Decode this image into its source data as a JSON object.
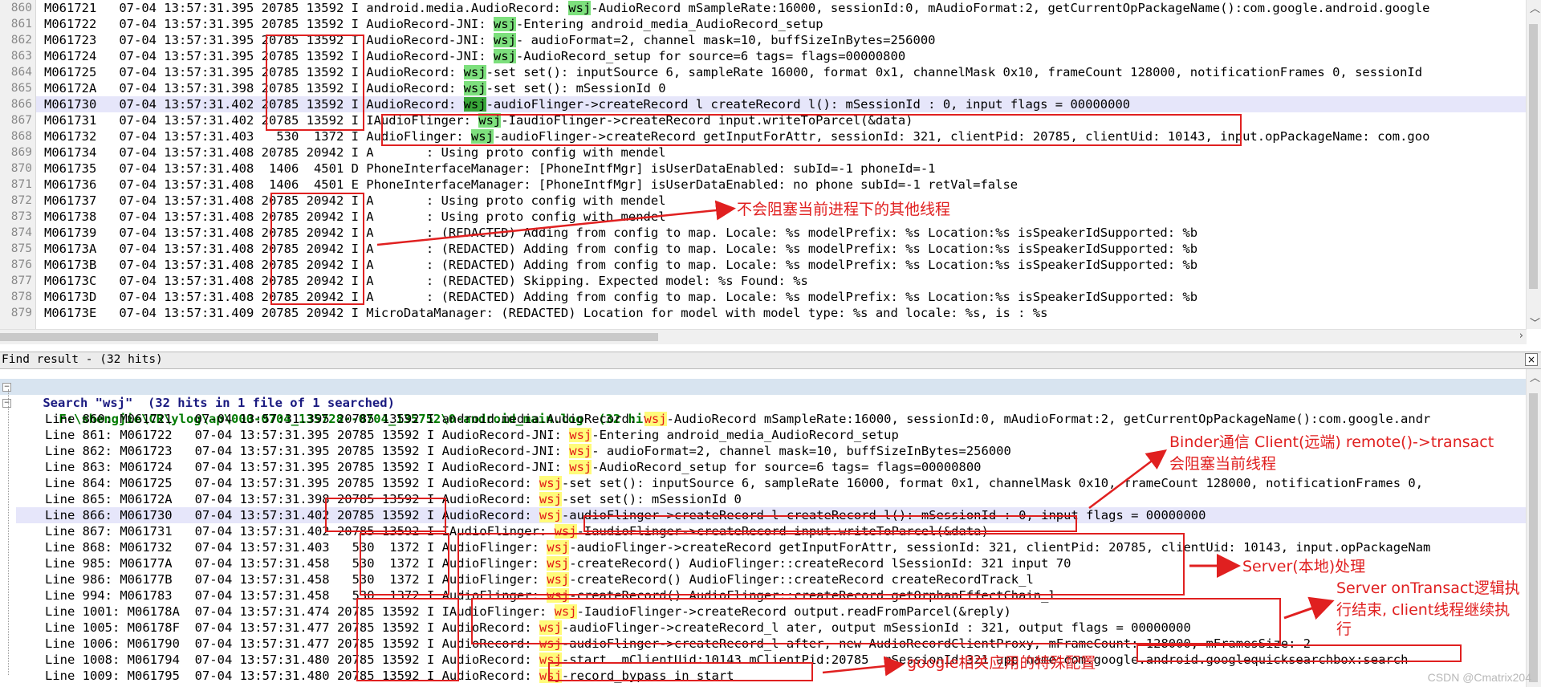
{
  "editor": {
    "line_numbers": [
      "860",
      "861",
      "862",
      "863",
      "864",
      "865",
      "866",
      "867",
      "868",
      "869",
      "870",
      "871",
      "872",
      "873",
      "874",
      "875",
      "876",
      "877",
      "878",
      "879"
    ],
    "lines": [
      {
        "pre": "M061721   07-04 13:57:31.395 20785 13592 I android.media.AudioRecord: ",
        "hit": "wsj",
        "post": "-AudioRecord mSampleRate:16000, sessionId:0, mAudioFormat:2, getCurrentOpPackageName():com.google.android.google"
      },
      {
        "pre": "M061722   07-04 13:57:31.395 20785 13592 I AudioRecord-JNI: ",
        "hit": "wsj",
        "post": "-Entering android_media_AudioRecord_setup"
      },
      {
        "pre": "M061723   07-04 13:57:31.395 20785 13592 I AudioRecord-JNI: ",
        "hit": "wsj",
        "post": "- audioFormat=2, channel mask=10, buffSizeInBytes=256000"
      },
      {
        "pre": "M061724   07-04 13:57:31.395 20785 13592 I AudioRecord-JNI: ",
        "hit": "wsj",
        "post": "-AudioRecord_setup for source=6 tags= flags=00000800"
      },
      {
        "pre": "M061725   07-04 13:57:31.395 20785 13592 I AudioRecord: ",
        "hit": "wsj",
        "post": "-set set(): inputSource 6, sampleRate 16000, format 0x1, channelMask 0x10, frameCount 128000, notificationFrames 0, sessionId"
      },
      {
        "pre": "M06172A   07-04 13:57:31.398 20785 13592 I AudioRecord: ",
        "hit": "wsj",
        "post": "-set set(): mSessionId 0"
      },
      {
        "pre": "M061730   07-04 13:57:31.402 20785 13592 I AudioRecord: ",
        "hit": "wsj",
        "post": "-audioFlinger->createRecord l createRecord l(): mSessionId : 0, input flags = 00000000",
        "current": true
      },
      {
        "pre": "M061731   07-04 13:57:31.402 20785 13592 I IAudioFlinger: ",
        "hit": "wsj",
        "post": "-IaudioFlinger->createRecord input.writeToParcel(&data)"
      },
      {
        "pre": "M061732   07-04 13:57:31.403   530  1372 I AudioFlinger: ",
        "hit": "wsj",
        "post": "-audioFlinger->createRecord getInputForAttr, sessionId: 321, clientPid: 20785, clientUid: 10143, input.opPackageName: com.goo"
      },
      {
        "pre": "M061734   07-04 13:57:31.408 20785 20942 I A       : Using proto config with mendel",
        "hit": "",
        "post": ""
      },
      {
        "pre": "M061735   07-04 13:57:31.408  1406  4501 D PhoneInterfaceManager: [PhoneIntfMgr] isUserDataEnabled: subId=-1 phoneId=-1",
        "hit": "",
        "post": ""
      },
      {
        "pre": "M061736   07-04 13:57:31.408  1406  4501 E PhoneInterfaceManager: [PhoneIntfMgr] isUserDataEnabled: no phone subId=-1 retVal=false",
        "hit": "",
        "post": ""
      },
      {
        "pre": "M061737   07-04 13:57:31.408 20785 20942 I A       : Using proto config with mendel",
        "hit": "",
        "post": ""
      },
      {
        "pre": "M061738   07-04 13:57:31.408 20785 20942 I A       : Using proto config with mendel",
        "hit": "",
        "post": ""
      },
      {
        "pre": "M061739   07-04 13:57:31.408 20785 20942 I A       : (REDACTED) Adding from config to map. Locale: %s modelPrefix: %s Location:%s isSpeakerIdSupported: %b",
        "hit": "",
        "post": ""
      },
      {
        "pre": "M06173A   07-04 13:57:31.408 20785 20942 I A       : (REDACTED) Adding from config to map. Locale: %s modelPrefix: %s Location:%s isSpeakerIdSupported: %b",
        "hit": "",
        "post": ""
      },
      {
        "pre": "M06173B   07-04 13:57:31.408 20785 20942 I A       : (REDACTED) Adding from config to map. Locale: %s modelPrefix: %s Location:%s isSpeakerIdSupported: %b",
        "hit": "",
        "post": ""
      },
      {
        "pre": "M06173C   07-04 13:57:31.408 20785 20942 I A       : (REDACTED) Skipping. Expected model: %s Found: %s",
        "hit": "",
        "post": ""
      },
      {
        "pre": "M06173D   07-04 13:57:31.408 20785 20942 I A       : (REDACTED) Adding from config to map. Locale: %s modelPrefix: %s Location:%s isSpeakerIdSupported: %b",
        "hit": "",
        "post": ""
      },
      {
        "pre": "M06173E   07-04 13:57:31.409 20785 20942 I MicroDataManager: (REDACTED) Location for model with model type: %s and locale: %s, is : %s",
        "hit": "",
        "post": ""
      }
    ]
  },
  "find_panel": {
    "title": "Find result -  (32 hits)",
    "close_glyph": "×",
    "search_header": "Search \"wsj\"  (32 hits in 1 file of 1 searched)",
    "file_header": "F:\\shengjie\\CR\\ylog\\ap\\000-0704_135728--0704_135752\\0-android_main.log  (32 hits)",
    "rows": [
      {
        "pre": "Line 860: M061721   07-04 13:57:31.395 20785 13592 I android.media.AudioRecord: ",
        "hit": "wsj",
        "post": "-AudioRecord mSampleRate:16000, sessionId:0, mAudioFormat:2, getCurrentOpPackageName():com.google.andr"
      },
      {
        "pre": "Line 861: M061722   07-04 13:57:31.395 20785 13592 I AudioRecord-JNI: ",
        "hit": "wsj",
        "post": "-Entering android_media_AudioRecord_setup"
      },
      {
        "pre": "Line 862: M061723   07-04 13:57:31.395 20785 13592 I AudioRecord-JNI: ",
        "hit": "wsj",
        "post": "- audioFormat=2, channel mask=10, buffSizeInBytes=256000"
      },
      {
        "pre": "Line 863: M061724   07-04 13:57:31.395 20785 13592 I AudioRecord-JNI: ",
        "hit": "wsj",
        "post": "-AudioRecord_setup for source=6 tags= flags=00000800"
      },
      {
        "pre": "Line 864: M061725   07-04 13:57:31.395 20785 13592 I AudioRecord: ",
        "hit": "wsj",
        "post": "-set set(): inputSource 6, sampleRate 16000, format 0x1, channelMask 0x10, frameCount 128000, notificationFrames 0,"
      },
      {
        "pre": "Line 865: M06172A   07-04 13:57:31.398 20785 13592 I AudioRecord: ",
        "hit": "wsj",
        "post": "-set set(): mSessionId 0"
      },
      {
        "pre": "Line 866: M061730   07-04 13:57:31.402 20785 13592 I AudioRecord: ",
        "hit": "wsj",
        "post": "-audioFlinger->createRecord l createRecord l(): mSessionId : 0, input flags = 00000000",
        "current": true
      },
      {
        "pre": "Line 867: M061731   07-04 13:57:31.402 20785 13592 I IAudioFlinger: ",
        "hit": "wsj",
        "post": "-IaudioFlinger->createRecord input.writeToParcel(&data)"
      },
      {
        "pre": "Line 868: M061732   07-04 13:57:31.403   530  1372 I AudioFlinger: ",
        "hit": "wsj",
        "post": "-audioFlinger->createRecord getInputForAttr, sessionId: 321, clientPid: 20785, clientUid: 10143, input.opPackageNam"
      },
      {
        "pre": "Line 985: M06177A   07-04 13:57:31.458   530  1372 I AudioFlinger: ",
        "hit": "wsj",
        "post": "-createRecord() AudioFlinger::createRecord lSessionId: 321 input 70"
      },
      {
        "pre": "Line 986: M06177B   07-04 13:57:31.458   530  1372 I AudioFlinger: ",
        "hit": "wsj",
        "post": "-createRecord() AudioFlinger::createRecord createRecordTrack_l"
      },
      {
        "pre": "Line 994: M061783   07-04 13:57:31.458   530  1372 I AudioFlinger: ",
        "hit": "wsj",
        "post": "-createRecord() AudioFlinger::createRecord getOrphanEffectChain_l"
      },
      {
        "pre": "Line 1001: M06178A  07-04 13:57:31.474 20785 13592 I IAudioFlinger: ",
        "hit": "wsj",
        "post": "-IaudioFlinger->createRecord output.readFromParcel(&reply)"
      },
      {
        "pre": "Line 1005: M06178F  07-04 13:57:31.477 20785 13592 I AudioRecord: ",
        "hit": "wsj",
        "post": "-audioFlinger->createRecord_l ater, output mSessionId : 321, output flags = 00000000"
      },
      {
        "pre": "Line 1006: M061790  07-04 13:57:31.477 20785 13592 I AudioRecord: ",
        "hit": "wsj",
        "post": "-audioFlinger->createRecord_l after, new AudioRecordClientProxy, mFrameCount: 128000, mFramesSize: 2"
      },
      {
        "pre": "Line 1008: M061794  07-04 13:57:31.480 20785 13592 I AudioRecord: ",
        "hit": "wsj",
        "post": "-start  mClientUid:10143 mClientPid:20785  mSessionId:321 app name:com.google.android.googlequicksearchbox:search"
      },
      {
        "pre": "Line 1009: M061795  07-04 13:57:31.480 20785 13592 I AudioRecord: ",
        "hit": "wsj",
        "post": "-record_bypass in start"
      }
    ]
  },
  "annotations": {
    "not_blocking": "不会阻塞当前进程下的其他线程",
    "binder_line1": "Binder通信 Client(远端) remote()->transact",
    "binder_line2": "会阻塞当前线程",
    "server_local": "Server(本地)处理",
    "server_done_1": "Server onTransact逻辑执",
    "server_done_2": "行结束, client线程继续执",
    "server_done_3": "行",
    "google_special": "google相关应用的特殊配置"
  },
  "colors": {
    "annotation_red": "#e02020",
    "editor_hit_green": "#7de07d",
    "result_hit_yellow": "#fffb7a",
    "current_line": "#e6e6fa"
  },
  "watermark": "CSDN @Cmatrix204"
}
